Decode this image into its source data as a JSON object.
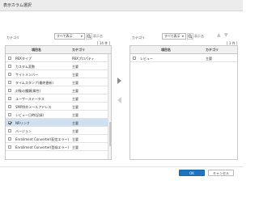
{
  "dialog": {
    "title": "表示カラム選択"
  },
  "left": {
    "category_label": "カテゴリ",
    "category_select": "すべて表示",
    "search_placeholder": "表示名",
    "count": "[ 14 件 ]",
    "headers": {
      "name": "項目名",
      "category": "カテゴリ"
    },
    "rows": [
      {
        "name": "PBXタイプ",
        "category": "PBXプロパティ",
        "checked": false,
        "selected": false
      },
      {
        "name": "カスタム変数",
        "category": "主要",
        "checked": false,
        "selected": false
      },
      {
        "name": "サイトメンバー",
        "category": "主要",
        "checked": false,
        "selected": false
      },
      {
        "name": "タイムスタンプ(最終更新)",
        "category": "主要",
        "checked": false,
        "selected": false
      },
      {
        "name": "対象の種類(属性)",
        "category": "主要",
        "checked": false,
        "selected": false
      },
      {
        "name": "ユーザーステータス",
        "category": "主要",
        "checked": false,
        "selected": false
      },
      {
        "name": "SMP除外メールアドレス",
        "category": "主要",
        "checked": false,
        "selected": false
      },
      {
        "name": "レビュー日時(記録)",
        "category": "主要",
        "checked": false,
        "selected": false
      },
      {
        "name": "NRリンク",
        "category": "主要",
        "checked": true,
        "selected": true
      },
      {
        "name": "バージョン",
        "category": "主要",
        "checked": false,
        "selected": false
      },
      {
        "name": "Enrollment Converter(配信エラー)",
        "category": "主要",
        "checked": false,
        "selected": false
      },
      {
        "name": "Enrollment Converter(登録エラー)",
        "category": "主要",
        "checked": false,
        "selected": false
      }
    ]
  },
  "right": {
    "category_label": "カテゴリ",
    "category_select": "すべて表示",
    "search_placeholder": "表示名",
    "count": "[ 1 件 ]",
    "headers": {
      "name": "項目名",
      "category": "カテゴリ"
    },
    "rows": [
      {
        "name": "レビュー",
        "category": "主要",
        "checked": false,
        "selected": false
      }
    ]
  },
  "footer": {
    "ok_label": "OK",
    "cancel_label": "キャンセル"
  },
  "colors": {
    "primary": "#1e73be",
    "selected_row": "#cfe0f3"
  },
  "icons": {
    "search": "search-icon",
    "move_right": "arrow-right-icon",
    "move_left": "arrow-left-icon",
    "sort_up": "arrow-up-icon",
    "sort_down": "arrow-down-icon"
  }
}
